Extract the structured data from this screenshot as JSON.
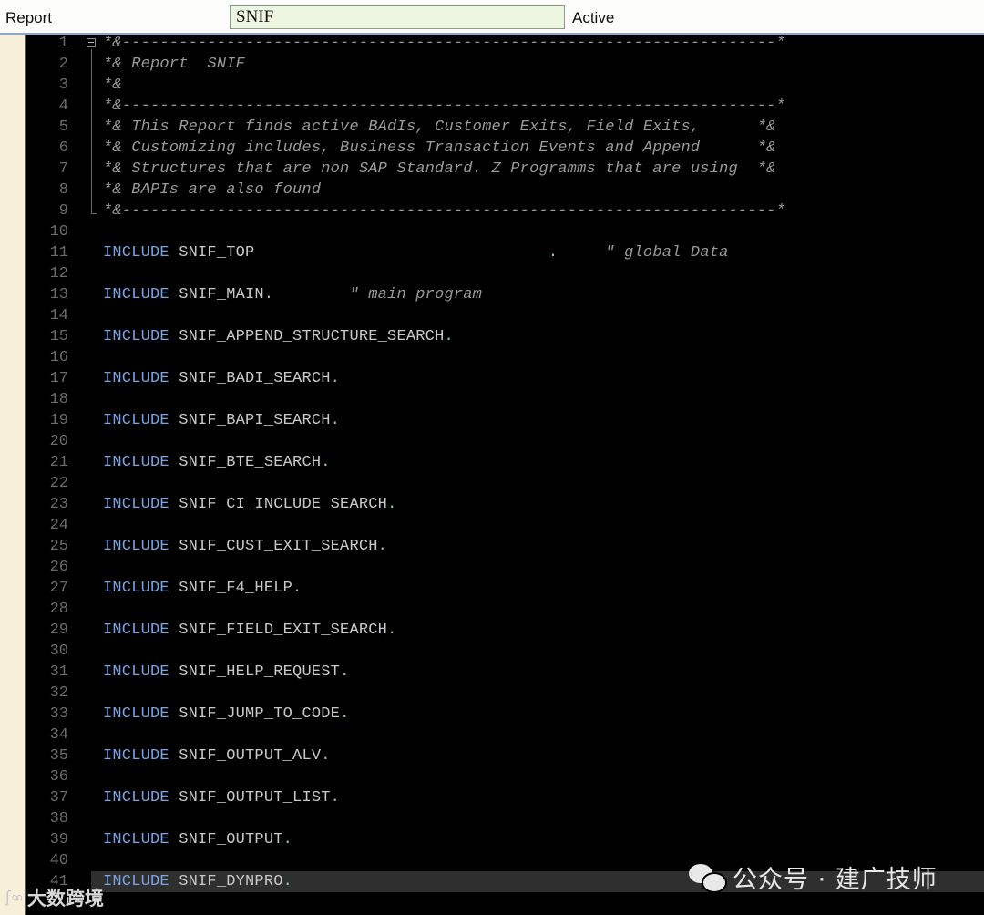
{
  "header": {
    "type_label": "Report",
    "program_name": "SNIF",
    "status": "Active"
  },
  "editor": {
    "lines": [
      {
        "n": "1",
        "kind": "comment",
        "text": "*&---------------------------------------------------------------------*"
      },
      {
        "n": "2",
        "kind": "comment",
        "text": "*& Report  SNIF"
      },
      {
        "n": "3",
        "kind": "comment",
        "text": "*&"
      },
      {
        "n": "4",
        "kind": "comment",
        "text": "*&---------------------------------------------------------------------*"
      },
      {
        "n": "5",
        "kind": "comment",
        "text": "*& This Report finds active BAdIs, Customer Exits, Field Exits,      *&"
      },
      {
        "n": "6",
        "kind": "comment",
        "text": "*& Customizing includes, Business Transaction Events and Append      *&"
      },
      {
        "n": "7",
        "kind": "comment",
        "text": "*& Structures that are non SAP Standard. Z Programms that are using  *&"
      },
      {
        "n": "8",
        "kind": "comment",
        "text": "*& BAPIs are also found"
      },
      {
        "n": "9",
        "kind": "comment",
        "text": "*&---------------------------------------------------------------------*"
      },
      {
        "n": "10",
        "kind": "blank",
        "text": ""
      },
      {
        "n": "11",
        "kind": "include",
        "keyword": "INCLUDE",
        "name": "SNIF_TOP",
        "gap": "                               ",
        "dot": ".",
        "comment": "     \" global Data"
      },
      {
        "n": "12",
        "kind": "blank",
        "text": ""
      },
      {
        "n": "13",
        "kind": "include",
        "keyword": "INCLUDE",
        "name": "SNIF_MAIN",
        "dot": ".",
        "comment": "        \" main program"
      },
      {
        "n": "14",
        "kind": "blank",
        "text": ""
      },
      {
        "n": "15",
        "kind": "include",
        "keyword": "INCLUDE",
        "name": "SNIF_APPEND_STRUCTURE_SEARCH",
        "dot": "."
      },
      {
        "n": "16",
        "kind": "blank",
        "text": ""
      },
      {
        "n": "17",
        "kind": "include",
        "keyword": "INCLUDE",
        "name": "SNIF_BADI_SEARCH",
        "dot": "."
      },
      {
        "n": "18",
        "kind": "blank",
        "text": ""
      },
      {
        "n": "19",
        "kind": "include",
        "keyword": "INCLUDE",
        "name": "SNIF_BAPI_SEARCH",
        "dot": "."
      },
      {
        "n": "20",
        "kind": "blank",
        "text": ""
      },
      {
        "n": "21",
        "kind": "include",
        "keyword": "INCLUDE",
        "name": "SNIF_BTE_SEARCH",
        "dot": "."
      },
      {
        "n": "22",
        "kind": "blank",
        "text": ""
      },
      {
        "n": "23",
        "kind": "include",
        "keyword": "INCLUDE",
        "name": "SNIF_CI_INCLUDE_SEARCH",
        "dot": "."
      },
      {
        "n": "24",
        "kind": "blank",
        "text": ""
      },
      {
        "n": "25",
        "kind": "include",
        "keyword": "INCLUDE",
        "name": "SNIF_CUST_EXIT_SEARCH",
        "dot": "."
      },
      {
        "n": "26",
        "kind": "blank",
        "text": ""
      },
      {
        "n": "27",
        "kind": "include",
        "keyword": "INCLUDE",
        "name": "SNIF_F4_HELP",
        "dot": "."
      },
      {
        "n": "28",
        "kind": "blank",
        "text": ""
      },
      {
        "n": "29",
        "kind": "include",
        "keyword": "INCLUDE",
        "name": "SNIF_FIELD_EXIT_SEARCH",
        "dot": "."
      },
      {
        "n": "30",
        "kind": "blank",
        "text": ""
      },
      {
        "n": "31",
        "kind": "include",
        "keyword": "INCLUDE",
        "name": "SNIF_HELP_REQUEST",
        "dot": "."
      },
      {
        "n": "32",
        "kind": "blank",
        "text": ""
      },
      {
        "n": "33",
        "kind": "include",
        "keyword": "INCLUDE",
        "name": "SNIF_JUMP_TO_CODE",
        "dot": "."
      },
      {
        "n": "34",
        "kind": "blank",
        "text": ""
      },
      {
        "n": "35",
        "kind": "include",
        "keyword": "INCLUDE",
        "name": "SNIF_OUTPUT_ALV",
        "dot": "."
      },
      {
        "n": "36",
        "kind": "blank",
        "text": ""
      },
      {
        "n": "37",
        "kind": "include",
        "keyword": "INCLUDE",
        "name": "SNIF_OUTPUT_LIST",
        "dot": "."
      },
      {
        "n": "38",
        "kind": "blank",
        "text": ""
      },
      {
        "n": "39",
        "kind": "include",
        "keyword": "INCLUDE",
        "name": "SNIF_OUTPUT",
        "dot": "."
      },
      {
        "n": "40",
        "kind": "blank",
        "text": ""
      },
      {
        "n": "41",
        "kind": "include",
        "keyword": "INCLUDE",
        "name": "SNIF_DYNPRO",
        "dot": ".",
        "current": true
      }
    ]
  },
  "watermark": {
    "account": "公众号 · 建广技师",
    "brand": "大数跨境"
  },
  "colors": {
    "editor_bg": "#000000",
    "keyword": "#7aa4e6",
    "identifier": "#c9c9c9",
    "comment": "#9a9a9a",
    "period": "#8ed08e",
    "line_number": "#6b6b6b",
    "current_line": "#2f2f2f"
  }
}
